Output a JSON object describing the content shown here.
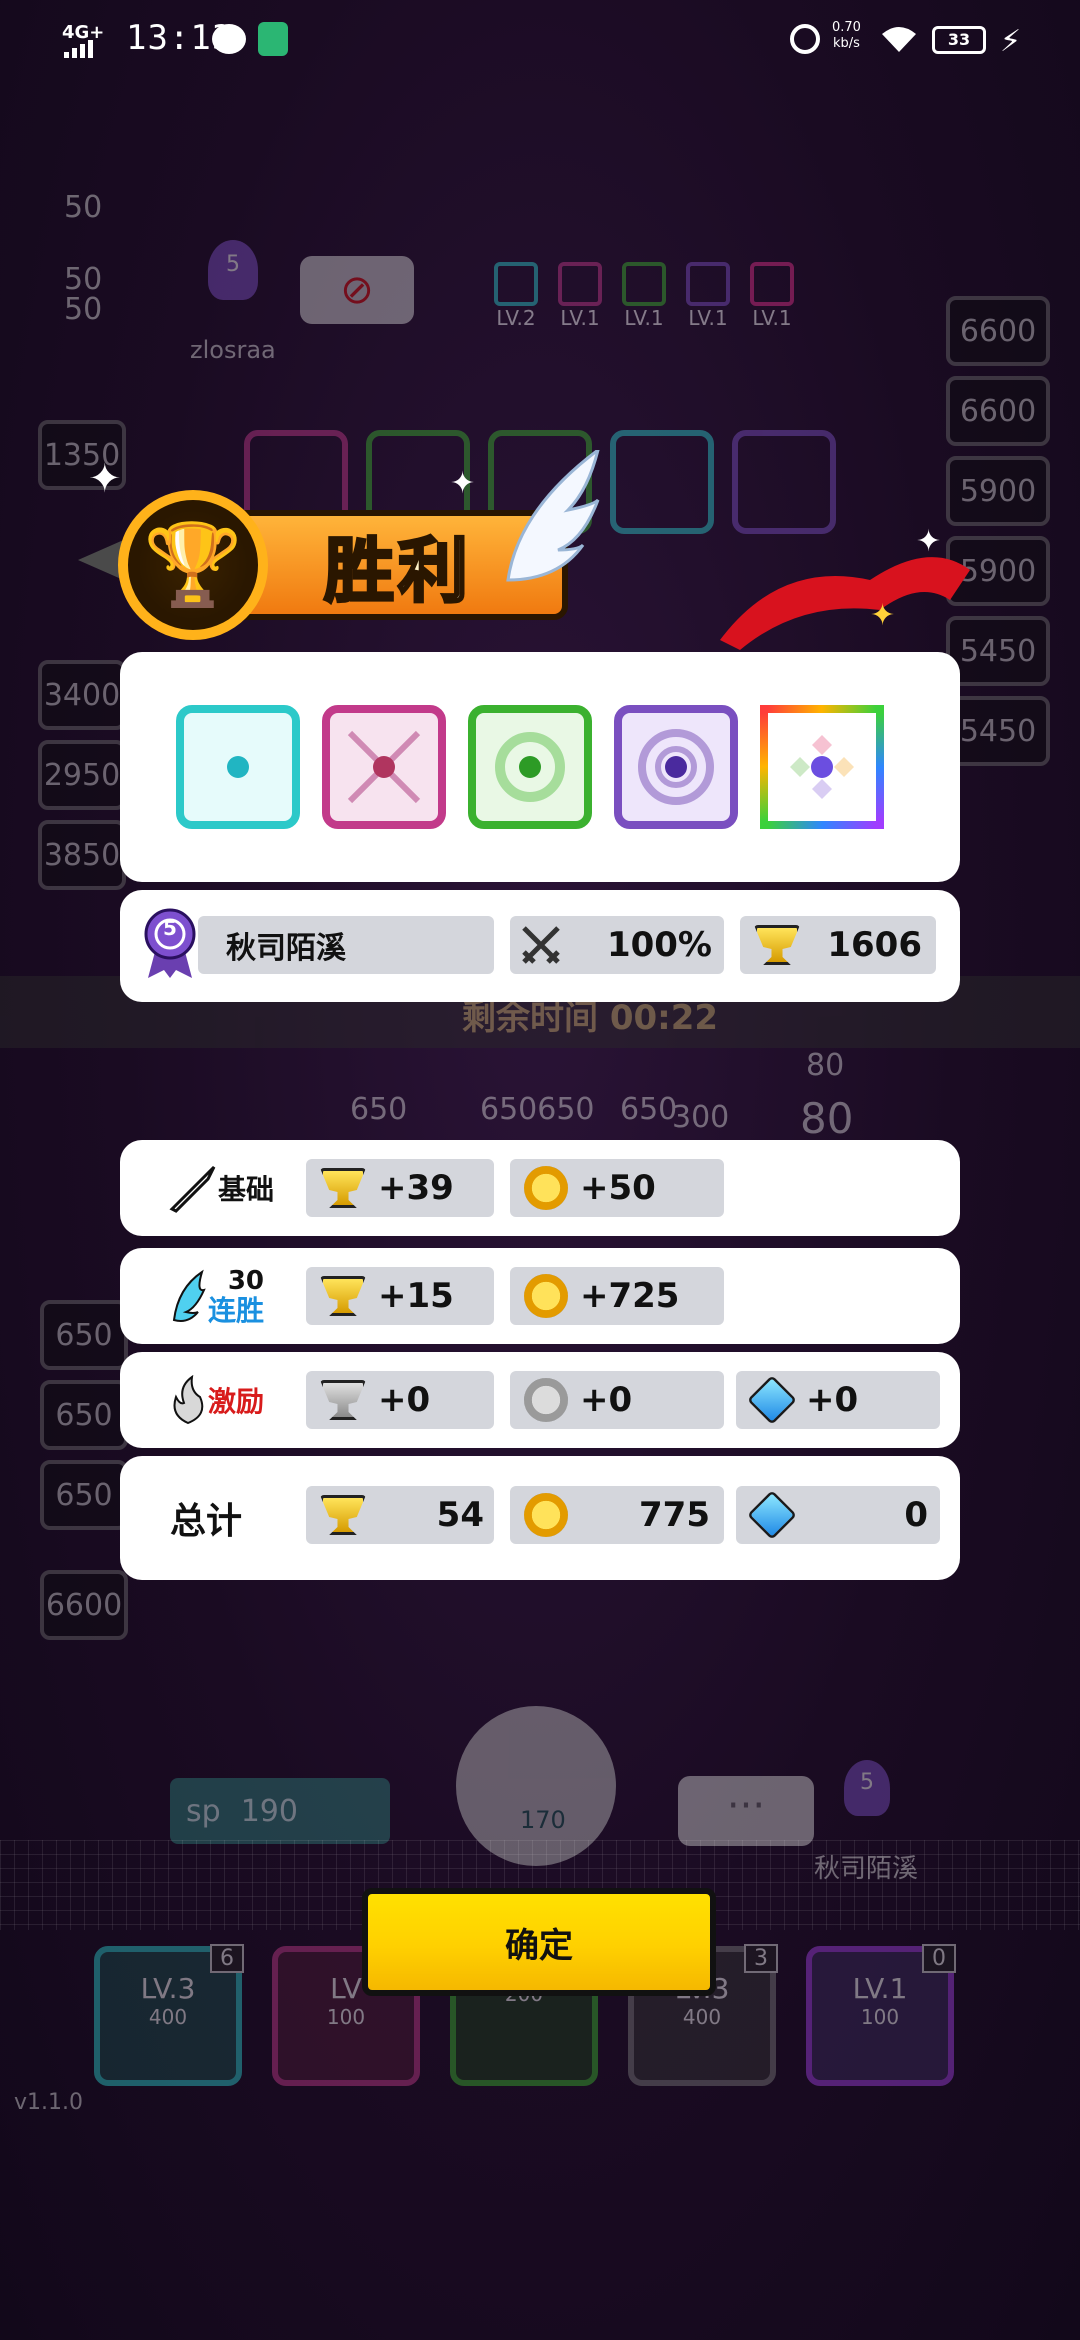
{
  "status_bar": {
    "network": "4G+",
    "time": "13:13",
    "speed_value": "0.70",
    "speed_unit": "kb/s",
    "battery": "33"
  },
  "background": {
    "opponent_name": "zlosraa",
    "opponent_level": "5",
    "opponent_dice_levels": [
      "LV.2",
      "LV.1",
      "LV.1",
      "LV.1",
      "LV.1"
    ],
    "left_column": [
      "1350",
      "3400",
      "2950",
      "3850"
    ],
    "right_column": [
      "6600",
      "6600",
      "5900",
      "5900",
      "5450",
      "5450"
    ],
    "lower_left_column": [
      "650",
      "650",
      "650",
      "6600"
    ],
    "top_left_numbers": [
      "50",
      "50",
      "50"
    ],
    "timer_label": "剩余时间 00:22",
    "middle_numbers": [
      "650",
      "650650",
      "650",
      "300",
      "80",
      "80"
    ],
    "sp_left": "190",
    "sp_center": "170",
    "player_level": "5",
    "player_name": "秋司陌溪",
    "bottom_dice": [
      {
        "level": "LV.3",
        "cost": "400",
        "count": "6"
      },
      {
        "level": "LV",
        "cost": "100",
        "count": ""
      },
      {
        "level": "",
        "cost": "200",
        "count": ""
      },
      {
        "level": "LV.3",
        "cost": "400",
        "count": "3"
      },
      {
        "level": "LV.1",
        "cost": "100",
        "count": "0"
      }
    ],
    "version": "v1.1.0"
  },
  "banner": {
    "title": "胜利"
  },
  "dice": [
    {
      "name": "ice-die",
      "border": "#2cc9c9",
      "fill": "#e6fbfb",
      "dot": "#21b5c2"
    },
    {
      "name": "poison-dragon-die",
      "border": "#c23a8a",
      "fill": "#f7e3ef",
      "dot": "#b0355f"
    },
    {
      "name": "wind-die",
      "border": "#3bb12f",
      "fill": "#e9f8e5",
      "dot": "#2d9b26"
    },
    {
      "name": "dragon-die",
      "border": "#7a4fc0",
      "fill": "#eee6fb",
      "dot": "#4a2a9e"
    },
    {
      "name": "rainbow-die",
      "border": "#e0308a",
      "fill": "#ffffff",
      "dot": "#6b4ee0"
    }
  ],
  "player_row": {
    "level": "5",
    "name": "秋司陌溪",
    "crit_value": "100%",
    "trophy_value": "1606"
  },
  "rewards": {
    "rows": [
      {
        "label": "基础",
        "trophies": "+39",
        "coins": "+50",
        "gems": ""
      },
      {
        "label": "连胜",
        "label_prefix": "30",
        "trophies": "+15",
        "coins": "+725",
        "gems": ""
      },
      {
        "label": "激励",
        "trophies": "+0",
        "coins": "+0",
        "gems": "+0"
      }
    ],
    "total": {
      "label": "总计",
      "trophies": "54",
      "coins": "775",
      "gems": "0"
    }
  },
  "confirm_label": "确定"
}
